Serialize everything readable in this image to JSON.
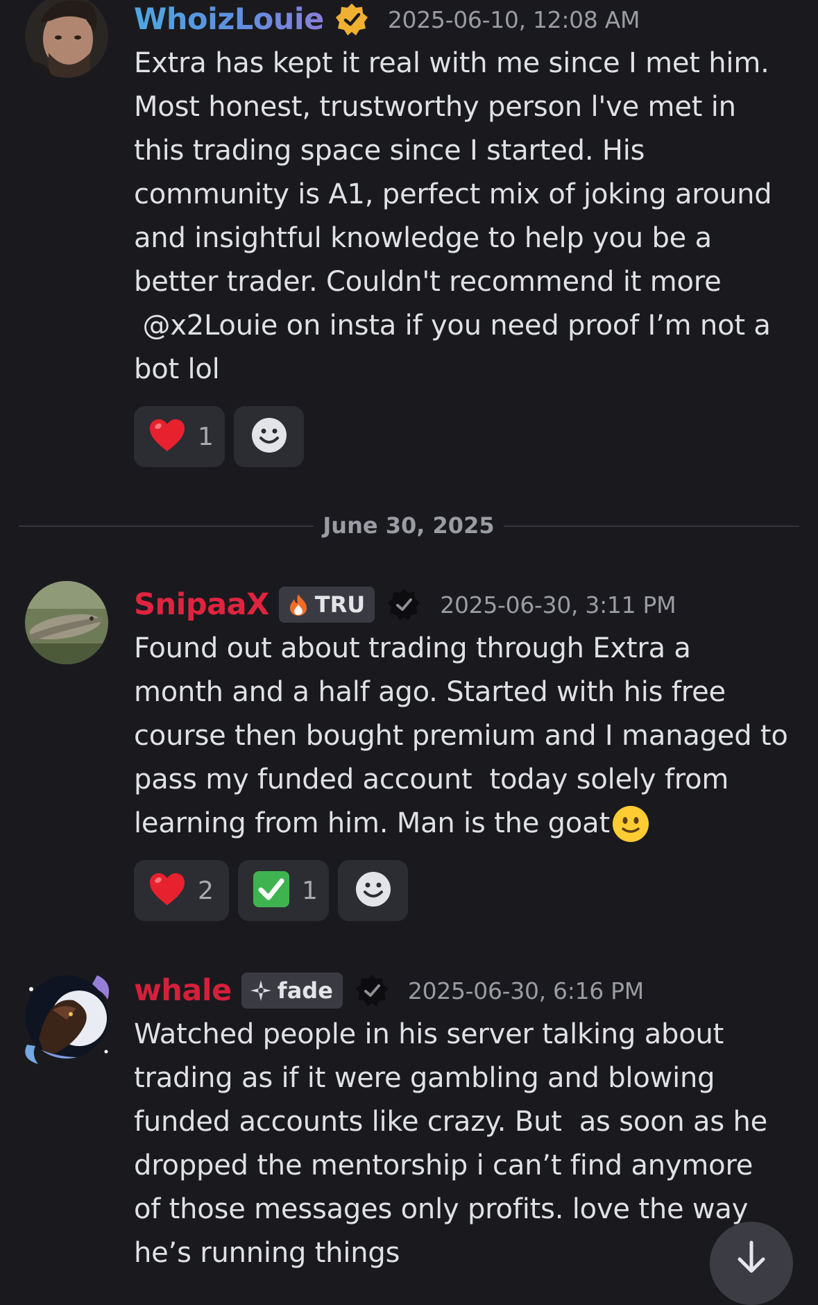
{
  "messages": [
    {
      "username": "WhoizLouie",
      "timestamp": "2025-06-10, 12:08 AM",
      "body_lines": [
        "Extra has kept it real with me since I met him.",
        "Most honest, trustworthy person l've met in",
        "this trading space since I started. His",
        "community is A1, perfect mix of joking around",
        "and insightful knowledge to help you be a",
        "better trader. Couldn't recommend it more",
        " @x2Louie on insta if you need proof I’m not a",
        "bot lol"
      ],
      "reactions": [
        {
          "emoji": "heart",
          "count": "1"
        }
      ]
    },
    {
      "username": "SnipaaX",
      "tag": "TRU",
      "timestamp": "2025-06-30, 3:11 PM",
      "body_lines": [
        "Found out about trading through Extra a",
        "month and a half ago. Started with his free",
        "course then bought premium and I managed to",
        "pass my funded account  today solely from",
        "learning from him. Man is the goat"
      ],
      "reactions": [
        {
          "emoji": "heart",
          "count": "2"
        },
        {
          "emoji": "check",
          "count": "1"
        }
      ]
    },
    {
      "username": "whale",
      "tag": "fade",
      "timestamp": "2025-06-30, 6:16 PM",
      "body_lines": [
        "Watched people in his server talking about",
        "trading as if it were gambling and blowing",
        "funded accounts like crazy. But  as soon as he",
        "dropped the mentorship i can’t find anymore",
        "of those messages only profits. love the way",
        "he’s running things"
      ]
    }
  ],
  "date_divider": "June 30, 2025",
  "colors": {
    "background": "#1a1a1e",
    "reaction_bg": "#2c2d32",
    "username_red": "#e0243f",
    "username_blue": "#4ea6df",
    "verified_gold": "#f0b132"
  },
  "icons": {
    "verified": "verified-badge-icon",
    "add_reaction": "add-reaction-icon",
    "scroll_down": "arrow-down-icon"
  }
}
